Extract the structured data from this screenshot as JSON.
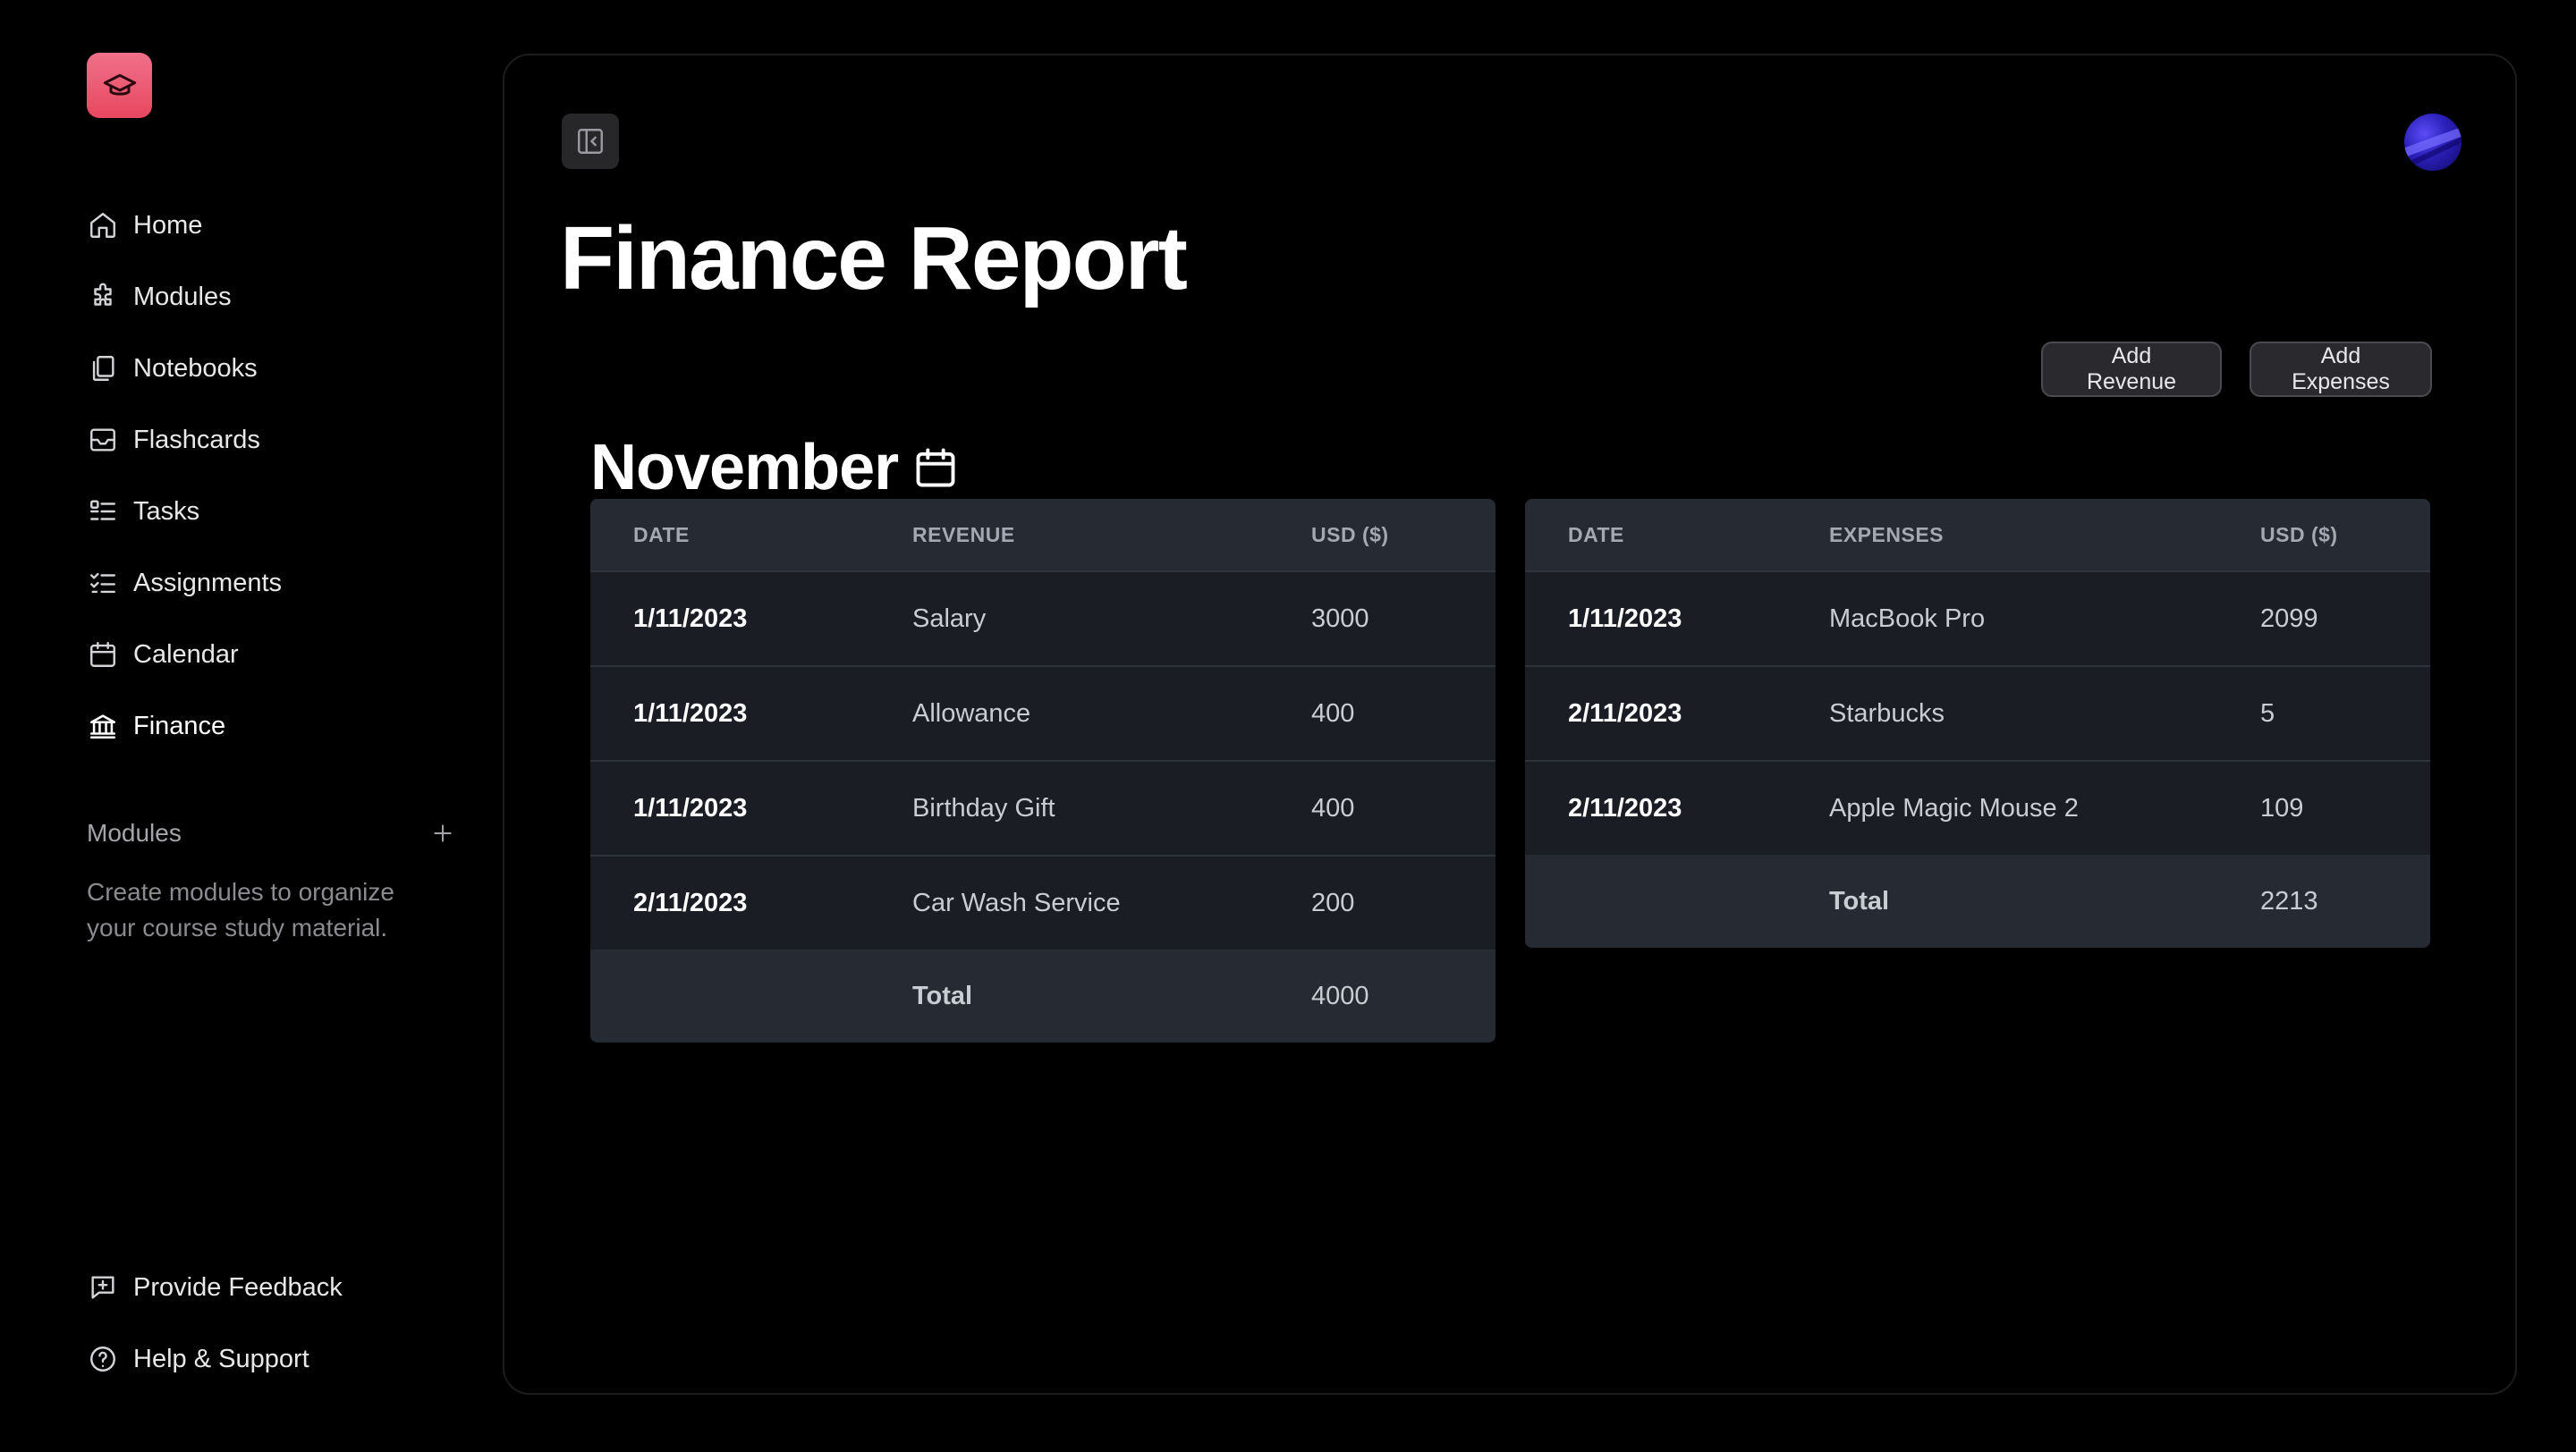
{
  "sidebar": {
    "nav": [
      {
        "label": "Home",
        "icon": "home-icon"
      },
      {
        "label": "Modules",
        "icon": "puzzle-icon"
      },
      {
        "label": "Notebooks",
        "icon": "notebook-icon"
      },
      {
        "label": "Flashcards",
        "icon": "flashcards-icon"
      },
      {
        "label": "Tasks",
        "icon": "tasks-icon"
      },
      {
        "label": "Assignments",
        "icon": "assignments-icon"
      },
      {
        "label": "Calendar",
        "icon": "calendar-icon"
      },
      {
        "label": "Finance",
        "icon": "bank-icon",
        "active": true
      }
    ],
    "modules_heading": "Modules",
    "modules_hint": "Create modules to organize your course study material.",
    "footer": [
      {
        "label": "Provide Feedback",
        "icon": "feedback-icon"
      },
      {
        "label": "Help & Support",
        "icon": "help-icon"
      }
    ]
  },
  "main": {
    "title": "Finance Report",
    "month": "November",
    "buttons": {
      "add_revenue": "Add Revenue",
      "add_expenses": "Add Expenses"
    },
    "revenue_table": {
      "headers": [
        "DATE",
        "REVENUE",
        "USD ($)"
      ],
      "rows": [
        {
          "date": "1/11/2023",
          "item": "Salary",
          "usd": "3000"
        },
        {
          "date": "1/11/2023",
          "item": "Allowance",
          "usd": "400"
        },
        {
          "date": "1/11/2023",
          "item": "Birthday Gift",
          "usd": "400"
        },
        {
          "date": "2/11/2023",
          "item": "Car Wash Service",
          "usd": "200"
        }
      ],
      "total_label": "Total",
      "total_value": "4000"
    },
    "expenses_table": {
      "headers": [
        "DATE",
        "EXPENSES",
        "USD ($)"
      ],
      "rows": [
        {
          "date": "1/11/2023",
          "item": "MacBook Pro",
          "usd": "2099"
        },
        {
          "date": "2/11/2023",
          "item": "Starbucks",
          "usd": "5"
        },
        {
          "date": "2/11/2023",
          "item": "Apple Magic Mouse 2",
          "usd": "109"
        }
      ],
      "total_label": "Total",
      "total_value": "2213"
    }
  },
  "colors": {
    "background": "#000000",
    "logo_accent": "#e8475f",
    "table_header": "#252a33",
    "table_body": "#1a1d23"
  }
}
